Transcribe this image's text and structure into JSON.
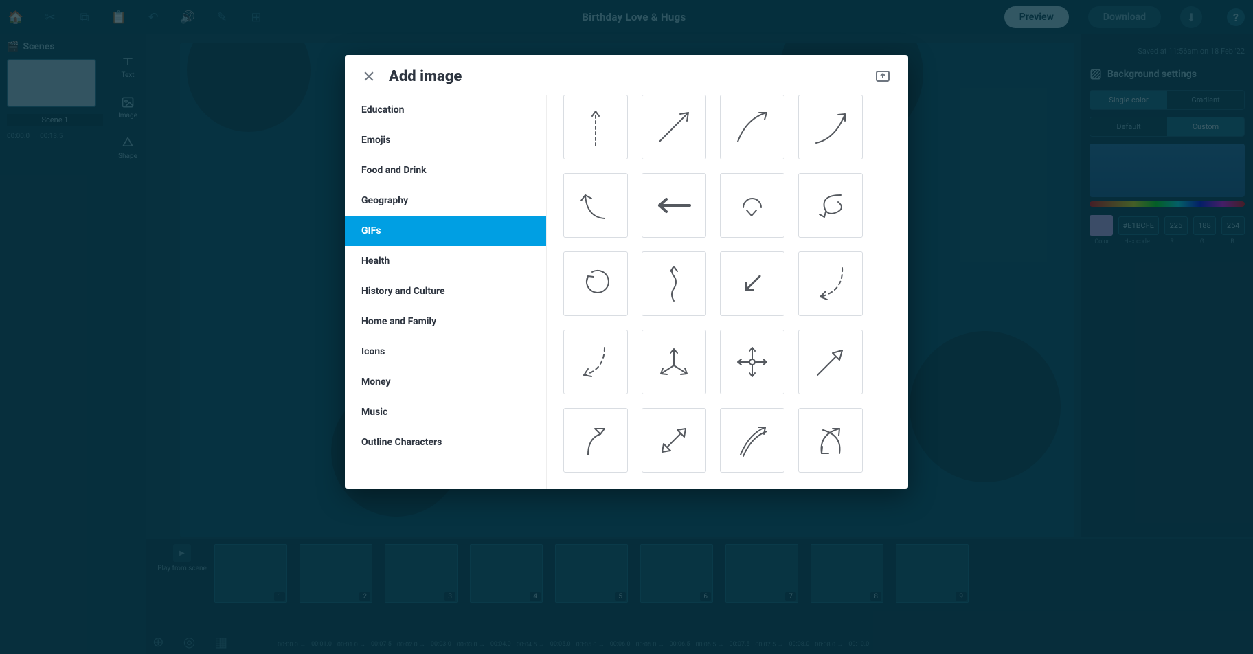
{
  "titlebar": {
    "title": "Birthday Love & Hugs",
    "preview": "Preview",
    "download": "Download"
  },
  "scenes": {
    "heading": "Scenes",
    "items": [
      {
        "label": "Scene 1",
        "time": "00:00.0  →  00:13.5"
      }
    ]
  },
  "tools": [
    {
      "id": "text",
      "label": "Text"
    },
    {
      "id": "image",
      "label": "Image"
    },
    {
      "id": "shape",
      "label": "Shape"
    }
  ],
  "rightpanel": {
    "saved": "Saved at 11:56am on 18 Feb '22",
    "heading": "Background settings",
    "tab1": [
      "Single color",
      "Gradient"
    ],
    "tab1_active": 0,
    "tab2": [
      "Default",
      "Custom"
    ],
    "tab2_active": 1,
    "color": {
      "hex": "#E1BCFE",
      "r": "225",
      "g": "188",
      "b": "254"
    },
    "labels": [
      "Color",
      "Hex code",
      "R",
      "G",
      "B"
    ]
  },
  "timeline": {
    "play_from": "Play from scene",
    "frame_count": 9,
    "times": [
      "00:00.0",
      "00:01.0",
      "00:01.0",
      "00:07.5",
      "00:02.0",
      "00:03.0",
      "00:03.0",
      "00:04.0",
      "00:04.5",
      "00:05.0",
      "00:05.0",
      "00:06.0",
      "00:06.0",
      "00:06.5",
      "00:06.5",
      "00:07.5",
      "00:07.5",
      "00:08.0",
      "00:08.0",
      "00:10.0"
    ]
  },
  "modal": {
    "title": "Add image",
    "categories": [
      "Education",
      "Emojis",
      "Food and Drink",
      "Geography",
      "GIFs",
      "Health",
      "History and Culture",
      "Home and Family",
      "Icons",
      "Money",
      "Music",
      "Outline Characters"
    ],
    "active_category": "GIFs",
    "items": [
      "arrow-up-dashed",
      "arrow-upright-straight",
      "arrow-upright-curve",
      "arrow-upright-swoosh",
      "arrow-back-left",
      "arrow-left-bold",
      "arrow-loop-down",
      "arrow-spiral",
      "arrow-circle",
      "arrow-wavy-up",
      "arrow-downleft-small",
      "arrow-dashed-curve-down",
      "arrow-dashed-curve-left",
      "arrow-three-way",
      "arrow-four-way",
      "arrow-upright-outline",
      "arrow-hook-up",
      "arrow-double-diag",
      "arrow-double-curve-up",
      "arrow-double-loop"
    ]
  }
}
